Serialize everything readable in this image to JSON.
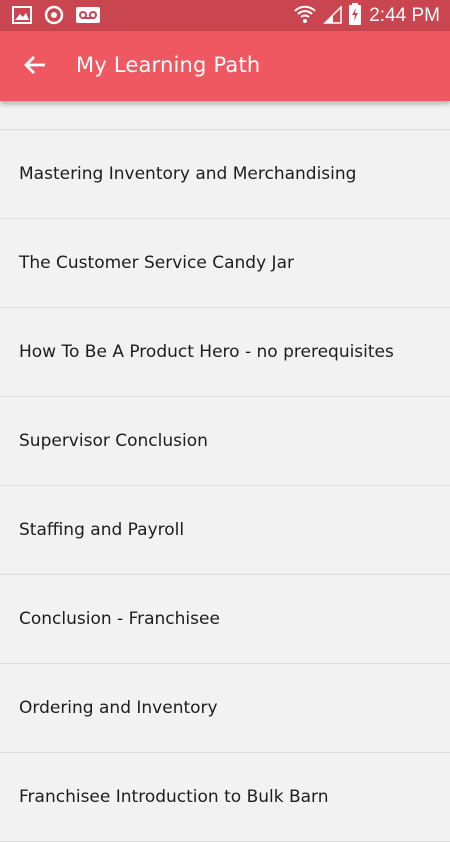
{
  "status_bar": {
    "time": "2:44 PM",
    "icons": [
      "gallery-icon",
      "sync-icon",
      "voicemail-icon",
      "wifi-icon",
      "signal-icon",
      "battery-charging-icon"
    ]
  },
  "app_bar": {
    "title": "My Learning Path",
    "back_icon": "arrow-back-icon"
  },
  "learning_path": {
    "items": [
      {
        "label": "Mastering Inventory and Merchandising"
      },
      {
        "label": "The Customer Service Candy Jar"
      },
      {
        "label": "How To Be A Product Hero - no prerequisites"
      },
      {
        "label": "Supervisor Conclusion"
      },
      {
        "label": "Staffing and Payroll"
      },
      {
        "label": "Conclusion - Franchisee"
      },
      {
        "label": "Ordering and Inventory"
      },
      {
        "label": "Franchisee Introduction to Bulk Barn"
      }
    ]
  },
  "colors": {
    "status_bar": "#c9454f",
    "app_bar": "#ef5860",
    "background": "#f2f2f2",
    "divider": "#dcdcdc"
  }
}
